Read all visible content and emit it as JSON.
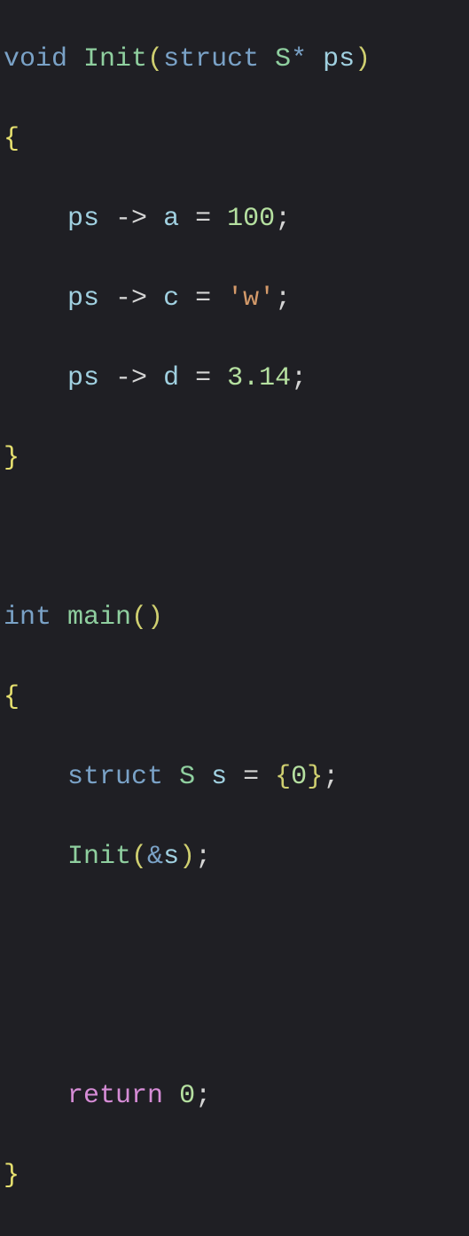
{
  "code": {
    "l1": {
      "kw_void": "void",
      "sp1": " ",
      "fn": "Init",
      "lp": "(",
      "kw_struct": "struct",
      "sp2": " ",
      "type": "S",
      "star": "*",
      "sp3": " ",
      "param": "ps",
      "rp": ")"
    },
    "l2": {
      "brace": "{"
    },
    "l3": {
      "indent": "    ",
      "var": "ps",
      "sp1": " ",
      "arrow": "->",
      "sp2": " ",
      "mem": "a",
      "sp3": " ",
      "eq": "=",
      "sp4": " ",
      "val": "100",
      "semi": ";"
    },
    "l4": {
      "indent": "    ",
      "var": "ps",
      "sp1": " ",
      "arrow": "->",
      "sp2": " ",
      "mem": "c",
      "sp3": " ",
      "eq": "=",
      "sp4": " ",
      "val": "'w'",
      "semi": ";"
    },
    "l5": {
      "indent": "    ",
      "var": "ps",
      "sp1": " ",
      "arrow": "->",
      "sp2": " ",
      "mem": "d",
      "sp3": " ",
      "eq": "=",
      "sp4": " ",
      "val": "3.14",
      "semi": ";"
    },
    "l6": {
      "brace": "}"
    },
    "l7": {
      "blank": " "
    },
    "l8": {
      "kw_int": "int",
      "sp1": " ",
      "fn": "main",
      "lp": "(",
      "rp": ")"
    },
    "l9": {
      "brace": "{"
    },
    "l10": {
      "indent": "    ",
      "kw_struct": "struct",
      "sp1": " ",
      "type": "S",
      "sp2": " ",
      "var": "s",
      "sp3": " ",
      "eq": "=",
      "sp4": " ",
      "lb": "{",
      "val": "0",
      "rb": "}",
      "semi": ";"
    },
    "l11": {
      "indent": "    ",
      "fn": "Init",
      "lp": "(",
      "amp": "&",
      "arg": "s",
      "rp": ")",
      "semi": ";"
    },
    "l12": {
      "blank": " "
    },
    "l13": {
      "blank": " "
    },
    "l14": {
      "indent": "    ",
      "kw_return": "return",
      "sp1": " ",
      "val": "0",
      "semi": ";"
    },
    "l15": {
      "brace": "}"
    }
  }
}
